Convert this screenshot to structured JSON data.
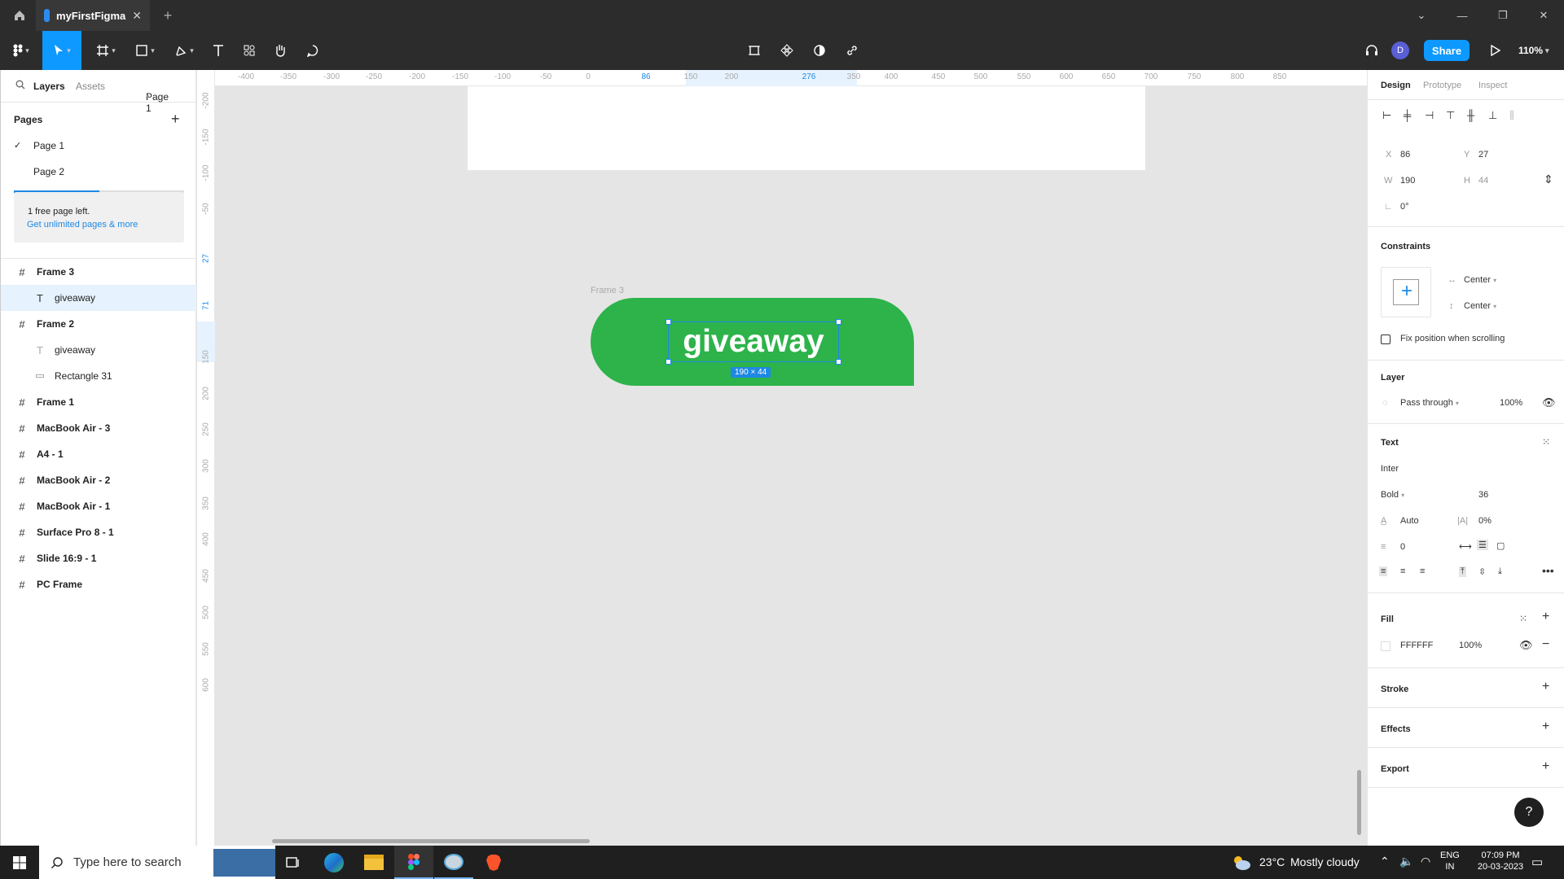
{
  "titlebar": {
    "tab_title": "myFirstFigma"
  },
  "toolbar": {
    "share_label": "Share",
    "avatar_initial": "D",
    "zoom": "110%"
  },
  "left_panel": {
    "tabs": [
      "Layers",
      "Assets"
    ],
    "page_selector": "Page 1",
    "pages_header": "Pages",
    "pages": [
      "Page 1",
      "Page 2"
    ],
    "pages_used_fraction": 0.5,
    "promo_text": "1 free page left.",
    "promo_link": "Get unlimited pages & more",
    "layers": [
      {
        "name": "Frame 3",
        "icon": "frame-icon"
      },
      {
        "name": "giveaway",
        "icon": "text-icon"
      },
      {
        "name": "Frame 2",
        "icon": "frame-icon"
      },
      {
        "name": "giveaway",
        "icon": "text-icon"
      },
      {
        "name": "Rectangle 31",
        "icon": "rectangle-icon"
      },
      {
        "name": "Frame 1",
        "icon": "frame-icon"
      },
      {
        "name": "MacBook Air - 3",
        "icon": "frame-icon"
      },
      {
        "name": "A4 - 1",
        "icon": "frame-icon"
      },
      {
        "name": "MacBook Air - 2",
        "icon": "frame-icon"
      },
      {
        "name": "MacBook Air - 1",
        "icon": "frame-icon"
      },
      {
        "name": "Surface Pro 8 - 1",
        "icon": "frame-icon"
      },
      {
        "name": "Slide 16:9 - 1",
        "icon": "frame-icon"
      },
      {
        "name": "PC Frame",
        "icon": "frame-icon"
      }
    ]
  },
  "canvas": {
    "ruler_top": [
      "-400",
      "-350",
      "-300",
      "-250",
      "-200",
      "-150",
      "-100",
      "-50",
      "0",
      "86",
      "150",
      "200",
      "276",
      "350",
      "400",
      "450",
      "500",
      "550",
      "600",
      "650",
      "700",
      "750",
      "800",
      "850"
    ],
    "ruler_left": [
      "-200",
      "-150",
      "-100",
      "-50",
      "27",
      "71",
      "150",
      "200",
      "250",
      "300",
      "350",
      "400",
      "450",
      "500",
      "550",
      "600"
    ],
    "frame_label": "Frame 3",
    "button_text": "giveaway",
    "size_badge": "190 × 44",
    "colors": {
      "frame_fill": "#2db34a",
      "selection": "#1e88e5"
    }
  },
  "right_panel": {
    "tabs": [
      "Design",
      "Prototype",
      "Inspect"
    ],
    "x_label": "X",
    "x_value": "86",
    "y_label": "Y",
    "y_value": "27",
    "w_label": "W",
    "w_value": "190",
    "h_label": "H",
    "h_value": "44",
    "rotation": "0°",
    "constraints_header": "Constraints",
    "constraint_h": "Center",
    "constraint_v": "Center",
    "fix_position_label": "Fix position when scrolling",
    "layer_header": "Layer",
    "blend_mode": "Pass through",
    "layer_opacity": "100%",
    "text_header": "Text",
    "font_family": "Inter",
    "font_weight": "Bold",
    "font_size": "36",
    "line_height": "Auto",
    "letter_spacing": "0%",
    "paragraph_spacing": "0",
    "fill_header": "Fill",
    "fill_hex": "FFFFFF",
    "fill_opacity": "100%",
    "stroke_header": "Stroke",
    "effects_header": "Effects",
    "export_header": "Export"
  },
  "taskbar": {
    "search_placeholder": "Type here to search",
    "weather_temp": "23°C",
    "weather_desc": "Mostly cloudy",
    "lang_line1": "ENG",
    "lang_line2": "IN",
    "time": "07:09 PM",
    "date": "20-03-2023"
  }
}
